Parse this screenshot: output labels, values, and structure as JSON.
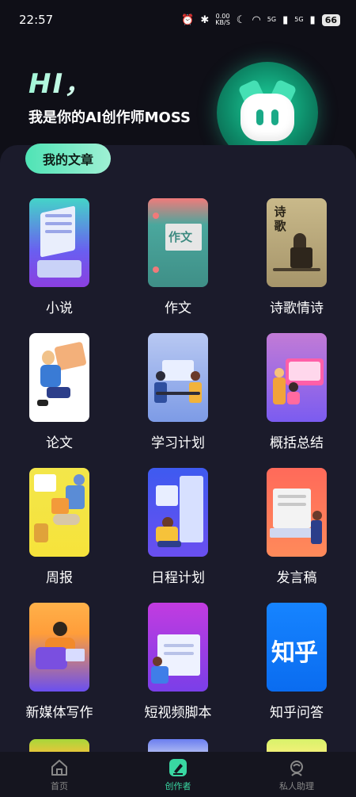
{
  "status_bar": {
    "time": "22:57",
    "speed_value": "0.00",
    "speed_unit": "KB/S",
    "signal1": "5G",
    "signal2": "5G",
    "battery": "66"
  },
  "hero": {
    "greeting": "HI，",
    "subtitle": "我是你的AI创作师MOSS"
  },
  "my_articles_button": "我的文章",
  "grid": {
    "items": [
      {
        "label": "小说"
      },
      {
        "label": "作文",
        "thumb_text": "作文"
      },
      {
        "label": "诗歌情诗",
        "thumb_text": "诗歌"
      },
      {
        "label": "论文"
      },
      {
        "label": "学习计划"
      },
      {
        "label": "概括总结"
      },
      {
        "label": "周报"
      },
      {
        "label": "日程计划"
      },
      {
        "label": "发言稿"
      },
      {
        "label": "新媒体写作"
      },
      {
        "label": "短视频脚本"
      },
      {
        "label": "知乎问答",
        "thumb_text": "知乎"
      }
    ]
  },
  "tabbar": {
    "tabs": [
      {
        "label": "首页",
        "icon": "home-icon"
      },
      {
        "label": "创作者",
        "icon": "pen-icon"
      },
      {
        "label": "私人助理",
        "icon": "assistant-icon"
      }
    ],
    "active_index": 1
  },
  "colors": {
    "accent": "#39d7a2",
    "background": "#0f0f17",
    "panel": "#1b1b2b"
  }
}
